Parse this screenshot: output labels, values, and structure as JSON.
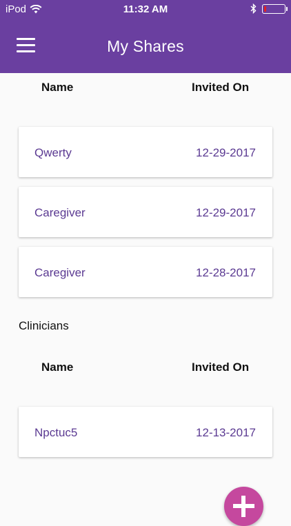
{
  "status_bar": {
    "carrier": "iPod",
    "time": "11:32 AM",
    "battery_level": 0.12
  },
  "header": {
    "title": "My Shares"
  },
  "shares": {
    "columns": {
      "name": "Name",
      "invited_on": "Invited On"
    },
    "rows": [
      {
        "name": "Qwerty",
        "date": "12-29-2017"
      },
      {
        "name": "Caregiver",
        "date": "12-29-2017"
      },
      {
        "name": "Caregiver",
        "date": "12-28-2017"
      }
    ]
  },
  "clinicians": {
    "label": "Clinicians",
    "columns": {
      "name": "Name",
      "invited_on": "Invited On"
    },
    "rows": [
      {
        "name": "Npctuc5",
        "date": "12-13-2017"
      }
    ]
  },
  "icons": {
    "menu": "hamburger-menu-icon",
    "wifi": "wifi-icon",
    "bluetooth": "bluetooth-icon",
    "battery": "battery-icon",
    "add": "plus-icon"
  },
  "colors": {
    "header": "#6a3fa0",
    "accent_text": "#5b3a92",
    "fab": "#c5489e"
  }
}
